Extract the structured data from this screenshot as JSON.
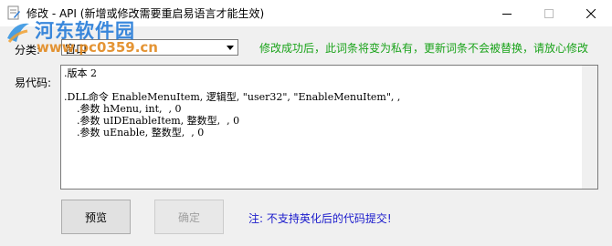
{
  "window": {
    "title": "修改 - API (新增或修改需要重启易语言才能生效)",
    "controls": {
      "minimize_icon": "minimize-icon",
      "maximize_icon": "maximize-icon",
      "close_icon": "close-icon"
    }
  },
  "watermark": {
    "site_name": "河东软件园",
    "url": "www.pc0359.cn"
  },
  "form": {
    "category_label": "分类:",
    "category_value": "窗口",
    "notice": "修改成功后，此词条将变为私有，更新词条不会被替换，请放心修改",
    "code_label": "易代码:",
    "code_lines": [
      ".版本 2",
      "",
      ".DLL命令 EnableMenuItem, 逻辑型, \"user32\", \"EnableMenuItem\", ,",
      "    .参数 hMenu, int,  , 0",
      "    .参数 uIDEnableItem, 整数型,  , 0",
      "    .参数 uEnable, 整数型,  , 0",
      ""
    ]
  },
  "buttons": {
    "preview_label": "预览",
    "confirm_label": "确定"
  },
  "footnote": "注: 不支持英化后的代码提交!",
  "colors": {
    "notice": "#1aa31a",
    "footnote": "#1a1acc",
    "watermark_title": "#1f78d8",
    "watermark_url": "#e2891f"
  }
}
